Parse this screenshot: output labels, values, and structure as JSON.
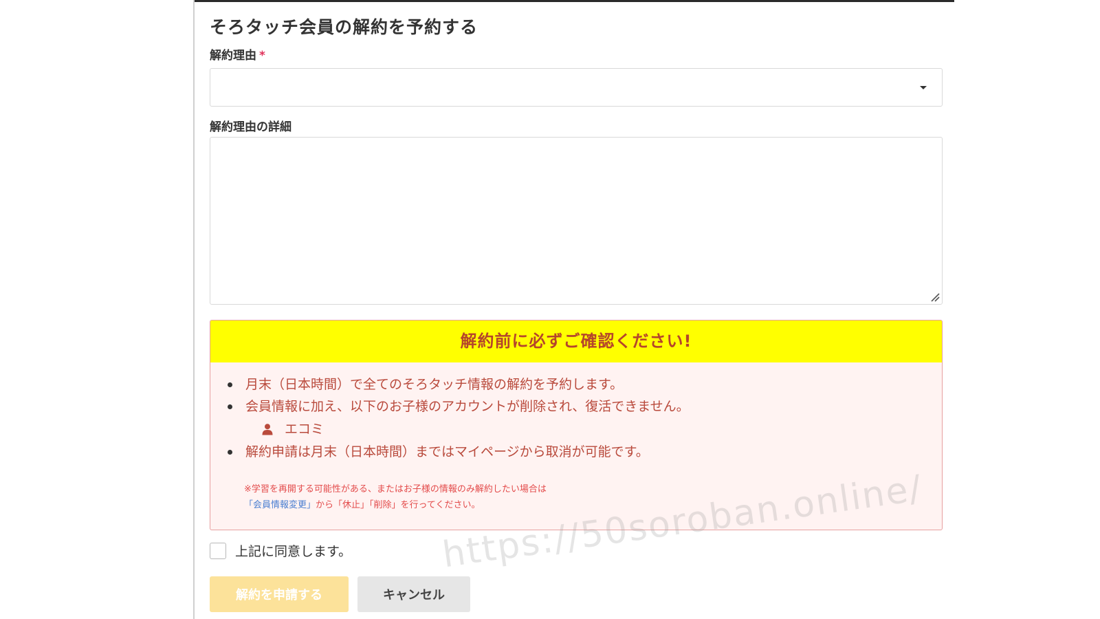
{
  "form": {
    "title": "そろタッチ会員の解約を予約する",
    "reason_label": "解約理由",
    "required_mark": "*",
    "reason_value": "",
    "detail_label": "解約理由の詳細",
    "detail_value": ""
  },
  "notice": {
    "header": "解約前に必ずご確認ください!",
    "items": [
      "月末（日本時間）で全てのそろタッチ情報の解約を予約します。",
      "会員情報に加え、以下のお子様のアカウントが削除され、復活できません。",
      "解約申請は月末（日本時間）まではマイページから取消が可能です。"
    ],
    "child_name": "エコミ",
    "footnote_line1": "※学習を再開する可能性がある、またはお子様の情報のみ解約したい場合は",
    "footnote_link": "「会員情報変更」",
    "footnote_line2_rest": "から「休止」「削除」を行ってください。"
  },
  "agreement": {
    "label": "上記に同意します。",
    "checked": false
  },
  "buttons": {
    "submit_label": "解約を申請する",
    "cancel_label": "キャンセル"
  },
  "watermark": "https://50soroban.online/",
  "colors": {
    "notice_header_bg": "#ffff00",
    "notice_text": "#b94a3c",
    "required": "#e0315a",
    "submit_bg": "#fce29a",
    "cancel_bg": "#e6e6e6"
  },
  "icons": {
    "select_caret": "caret-down-icon",
    "child_account": "user-icon",
    "textarea_resize": "resize-grip-icon"
  }
}
